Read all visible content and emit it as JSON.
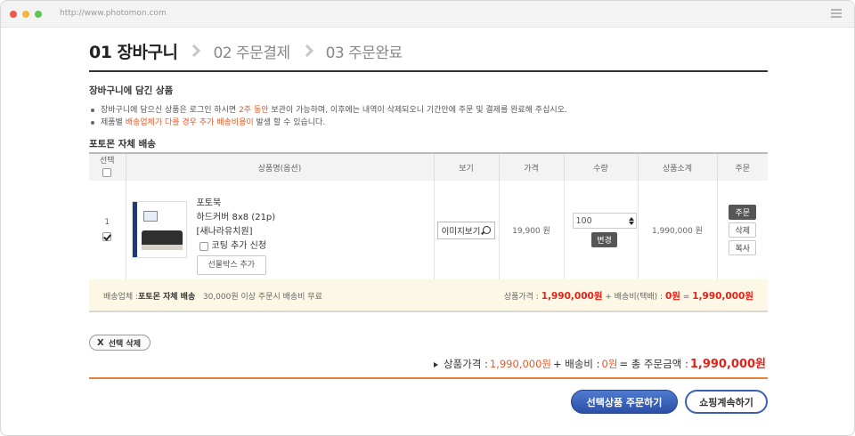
{
  "browser": {
    "url": "http://www.photomon.com"
  },
  "steps": [
    {
      "label": "01 장바구니",
      "active": true
    },
    {
      "label": "02 주문결제",
      "active": false
    },
    {
      "label": "03 주문완료",
      "active": false
    }
  ],
  "cart_section": {
    "title": "장바구니에 담긴 상품",
    "notes": {
      "note1_pre": "장바구니에 담으신 상품은 로그인 하시면 ",
      "note1_hl": "2주 동안",
      "note1_post": " 보관이 가능하며, 이후에는 내역이 삭제되오니 기간안에 주문 및 결제를 완료해 주십시오.",
      "note2_pre": "제품별 ",
      "note2_hl": "배송업체가 다를 경우 추가 배송비용이",
      "note2_post": " 발생 할 수 있습니다."
    }
  },
  "shipping_group": {
    "title": "포토몬 자체 배송"
  },
  "table": {
    "headers": {
      "select": "선택",
      "product": "상품명(옵션)",
      "view": "보기",
      "price": "가격",
      "qty": "수량",
      "subtotal": "상품소계",
      "order": "주문"
    },
    "row": {
      "number": "1",
      "checked": true,
      "product_name": "포토북",
      "option": "하드커버 8x8 (21p)",
      "theme": "[새나라유치원]",
      "coating_label": "코팅 추가 신청",
      "gift_button": "선물박스 추가",
      "view_button": "이미지보기",
      "price": "19,900 원",
      "quantity": "100",
      "change_button": "변경",
      "subtotal": "1,990,000 원",
      "order_button": "주문",
      "delete_button": "삭제",
      "copy_button": "복사"
    }
  },
  "shipping_bar": {
    "vendor_label": "배송업체 :",
    "vendor_name": "포토몬 자체 배송",
    "free_text": "30,000원 이상 주문시 배송비 무료",
    "price_label": "상품가격 :",
    "price_value": "1,990,000원",
    "plus_fee_label": "+ 배송비(택배) :",
    "fee_value": "0원",
    "equals": "=",
    "total_value": "1,990,000원"
  },
  "delete_selected": {
    "x": "X",
    "label": "선택 삭제"
  },
  "summary": {
    "price_label": "상품가격 :",
    "price_value": "1,990,000원",
    "plus_fee_label": "+ 배송비 :",
    "fee_value": "0원",
    "equals_label": "= 총 주문금액 :",
    "total_value": "1,990,000원"
  },
  "buttons": {
    "order_selected": "선택상품 주문하기",
    "continue_shopping": "쇼핑계속하기"
  },
  "colors": {
    "accent_orange": "#e25b2a",
    "total_red": "#e2231a",
    "primary_blue": "#2b50a8"
  }
}
